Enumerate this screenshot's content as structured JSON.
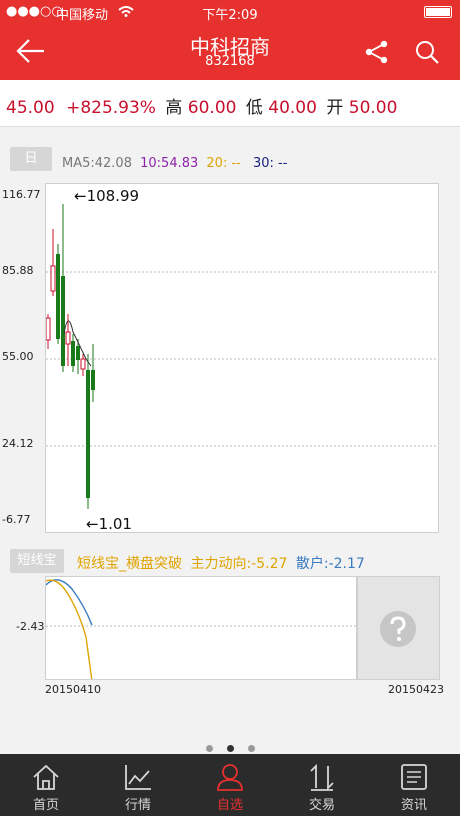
{
  "status_bar": {
    "carrier": "中国移动",
    "time": "下午2:09"
  },
  "header": {
    "title": "中科招商",
    "code": "832168"
  },
  "quote": {
    "price": "45.00",
    "change": "+825.93%",
    "high_label": "高",
    "high": "60.00",
    "low_label": "低",
    "low": "40.00",
    "open_label": "开",
    "open": "50.00"
  },
  "kline": {
    "period_tag": "日",
    "ma5": "MA5:42.08",
    "ma10": "10:54.83",
    "ma20": "20: --",
    "ma30": "30: --",
    "y_ticks": [
      "116.77",
      "85.88",
      "55.00",
      "24.12",
      "-6.77"
    ],
    "max_label": "108.99",
    "min_label": "1.01"
  },
  "indicator": {
    "tag": "短线宝",
    "name": "短线宝_横盘突破",
    "main_force": "主力动向:-5.27",
    "retail": "散户:-2.17",
    "y_tick": "-2.43",
    "date_start": "20150410",
    "date_end": "20150423",
    "help_icon": "question-icon"
  },
  "colors": {
    "brand_red": "#e6312f",
    "up": "#c8102e",
    "down": "#1a7a1a",
    "ma10": "#8e24aa",
    "ma20": "#e0a400",
    "ma30": "#1a237e",
    "retail": "#3a7bbf"
  },
  "tabs": [
    {
      "label": "首页",
      "icon": "home-icon"
    },
    {
      "label": "行情",
      "icon": "chart-icon"
    },
    {
      "label": "自选",
      "icon": "person-icon",
      "active": true
    },
    {
      "label": "交易",
      "icon": "trade-icon"
    },
    {
      "label": "资讯",
      "icon": "news-icon"
    }
  ]
}
